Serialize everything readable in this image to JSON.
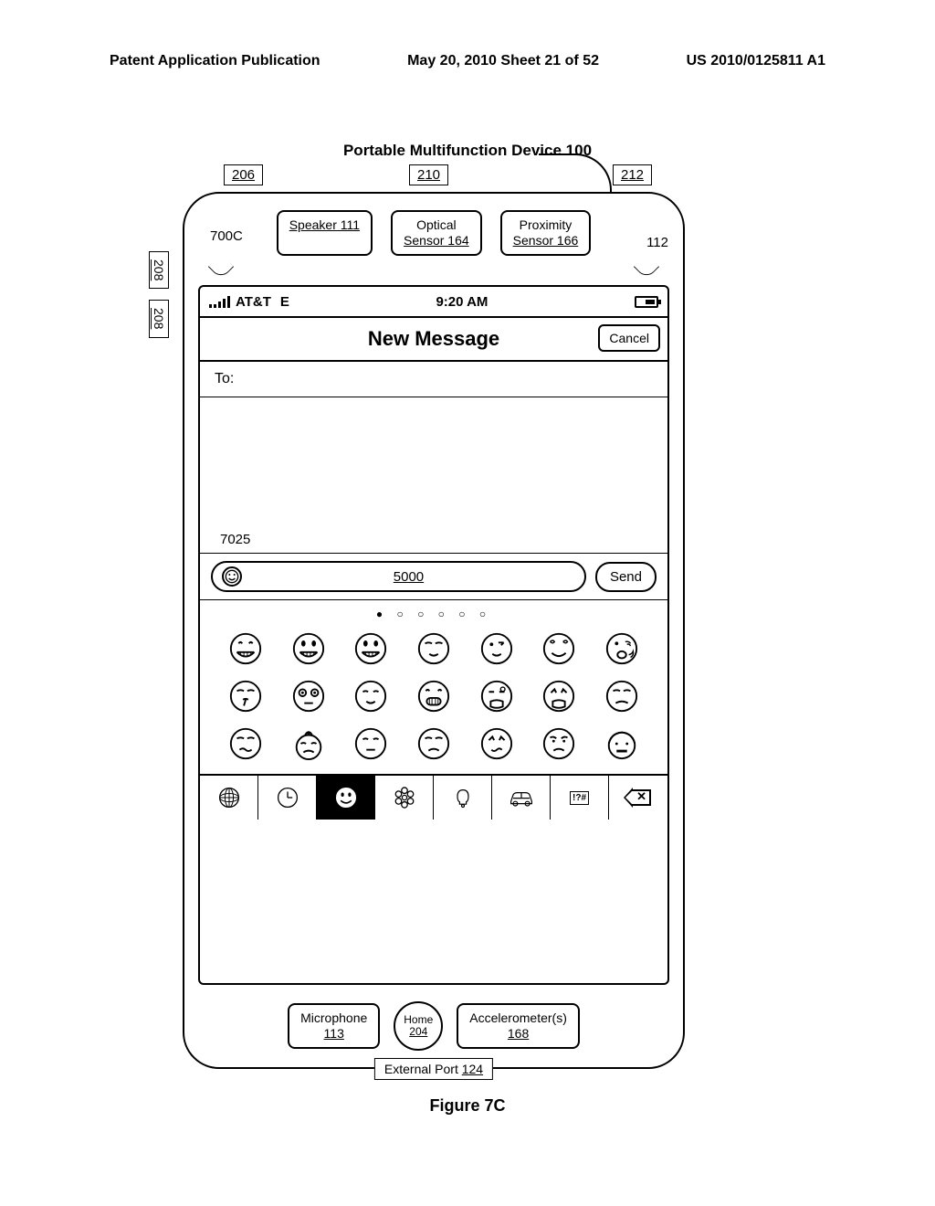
{
  "header": {
    "left": "Patent Application Publication",
    "center": "May 20, 2010  Sheet 21 of 52",
    "right": "US 2010/0125811 A1"
  },
  "device_title": "Portable Multifunction Device 100",
  "refs": {
    "r206": "206",
    "r210": "210",
    "r212": "212",
    "r208": "208",
    "r700c": "700C",
    "r112": "112",
    "r7025": "7025"
  },
  "hw": {
    "speaker": "Speaker 111",
    "optical_l1": "Optical",
    "optical_l2": "Sensor 164",
    "prox_l1": "Proximity",
    "prox_l2": "Sensor 166",
    "mic_l1": "Microphone",
    "mic_l2": "113",
    "home_l1": "Home",
    "home_l2": "204",
    "accel_l1": "Accelerometer(s)",
    "accel_l2": "168",
    "ext_port": "External Port 124"
  },
  "status": {
    "carrier": "AT&T",
    "net": "E",
    "time": "9:20 AM"
  },
  "title_bar": {
    "title": "New Message",
    "cancel": "Cancel"
  },
  "to_label": "To:",
  "compose": {
    "ref": "5000",
    "send": "Send"
  },
  "page_dots": "●  ○  ○  ○  ○  ○",
  "categories": {
    "symbols": "!?#"
  },
  "figure": "Figure 7C"
}
